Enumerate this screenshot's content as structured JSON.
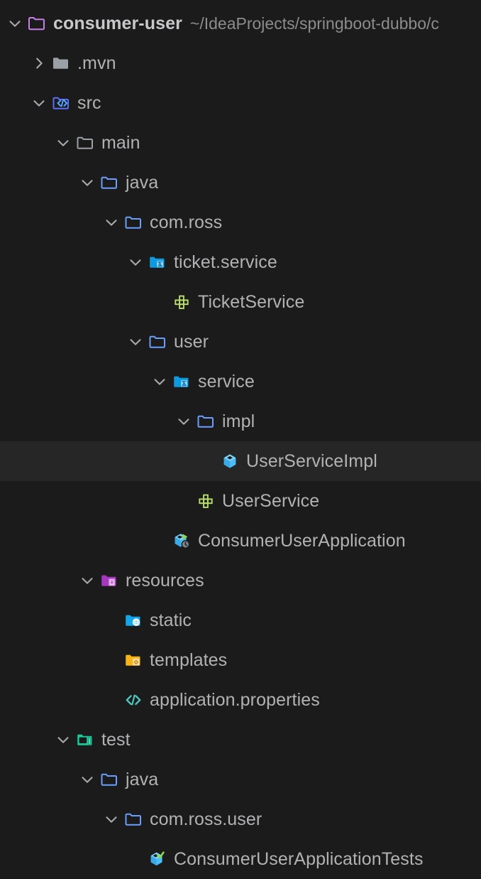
{
  "window": {
    "title": "Project tool window",
    "theme": "dark"
  },
  "colors": {
    "background": "#1b1b1b",
    "selection_background": "#262626",
    "text": "#b2b2b5",
    "dim_text": "#8c8c8f",
    "module_folder": "#c77fe8",
    "sources_root": "#6a9fff",
    "package": "#1f9ce0",
    "interface_green": "#b9e066",
    "class_blue": "#4fbdf5",
    "resources_purple": "#a638c0",
    "test_root_green": "#19c99a",
    "static_cyan": "#13a6e8",
    "templates_orange": "#f7b416",
    "properties_teal": "#4fc3bc"
  },
  "tree": {
    "nodes": [
      {
        "label": "consumer-user",
        "secondary": "~/IdeaProjects/springboot-dubbo/c",
        "depth": 0,
        "chevron": "down",
        "icon": "module-folder-icon",
        "bold": true,
        "selected": false
      },
      {
        "label": ".mvn",
        "secondary": "",
        "depth": 1,
        "chevron": "right",
        "icon": "folder-filled-gray-icon",
        "bold": false,
        "selected": false
      },
      {
        "label": "src",
        "secondary": "",
        "depth": 1,
        "chevron": "down",
        "icon": "source-folder-icon",
        "bold": false,
        "selected": false
      },
      {
        "label": "main",
        "secondary": "",
        "depth": 2,
        "chevron": "down",
        "icon": "folder-outline-gray-icon",
        "bold": false,
        "selected": false
      },
      {
        "label": "java",
        "secondary": "",
        "depth": 3,
        "chevron": "down",
        "icon": "folder-outline-blue-icon",
        "bold": false,
        "selected": false
      },
      {
        "label": "com.ross",
        "secondary": "",
        "depth": 4,
        "chevron": "down",
        "icon": "folder-outline-blue-icon",
        "bold": false,
        "selected": false
      },
      {
        "label": "ticket.service",
        "secondary": "",
        "depth": 5,
        "chevron": "down",
        "icon": "package-folder-icon",
        "bold": false,
        "selected": false
      },
      {
        "label": "TicketService",
        "secondary": "",
        "depth": 6,
        "chevron": "none",
        "icon": "interface-icon",
        "bold": false,
        "selected": false
      },
      {
        "label": "user",
        "secondary": "",
        "depth": 5,
        "chevron": "down",
        "icon": "folder-outline-blue-icon",
        "bold": false,
        "selected": false
      },
      {
        "label": "service",
        "secondary": "",
        "depth": 6,
        "chevron": "down",
        "icon": "package-folder-icon",
        "bold": false,
        "selected": false
      },
      {
        "label": "impl",
        "secondary": "",
        "depth": 7,
        "chevron": "down",
        "icon": "folder-outline-blue-icon",
        "bold": false,
        "selected": false
      },
      {
        "label": "UserServiceImpl",
        "secondary": "",
        "depth": 8,
        "chevron": "none",
        "icon": "class-icon",
        "bold": false,
        "selected": true
      },
      {
        "label": "UserService",
        "secondary": "",
        "depth": 7,
        "chevron": "none",
        "icon": "interface-icon",
        "bold": false,
        "selected": false
      },
      {
        "label": "ConsumerUserApplication",
        "secondary": "",
        "depth": 6,
        "chevron": "none",
        "icon": "runnable-class-icon",
        "bold": false,
        "selected": false
      },
      {
        "label": "resources",
        "secondary": "",
        "depth": 3,
        "chevron": "down",
        "icon": "resources-folder-icon",
        "bold": false,
        "selected": false
      },
      {
        "label": "static",
        "secondary": "",
        "depth": 4,
        "chevron": "none",
        "icon": "static-web-folder-icon",
        "bold": false,
        "selected": false
      },
      {
        "label": "templates",
        "secondary": "",
        "depth": 4,
        "chevron": "none",
        "icon": "templates-folder-icon",
        "bold": false,
        "selected": false
      },
      {
        "label": "application.properties",
        "secondary": "",
        "depth": 4,
        "chevron": "none",
        "icon": "properties-file-icon",
        "bold": false,
        "selected": false
      },
      {
        "label": "test",
        "secondary": "",
        "depth": 2,
        "chevron": "down",
        "icon": "test-folder-icon",
        "bold": false,
        "selected": false
      },
      {
        "label": "java",
        "secondary": "",
        "depth": 3,
        "chevron": "down",
        "icon": "folder-outline-blue-icon",
        "bold": false,
        "selected": false
      },
      {
        "label": "com.ross.user",
        "secondary": "",
        "depth": 4,
        "chevron": "down",
        "icon": "folder-outline-blue-icon",
        "bold": false,
        "selected": false
      },
      {
        "label": "ConsumerUserApplicationTests",
        "secondary": "",
        "depth": 5,
        "chevron": "none",
        "icon": "test-class-icon",
        "bold": false,
        "selected": false
      }
    ]
  }
}
